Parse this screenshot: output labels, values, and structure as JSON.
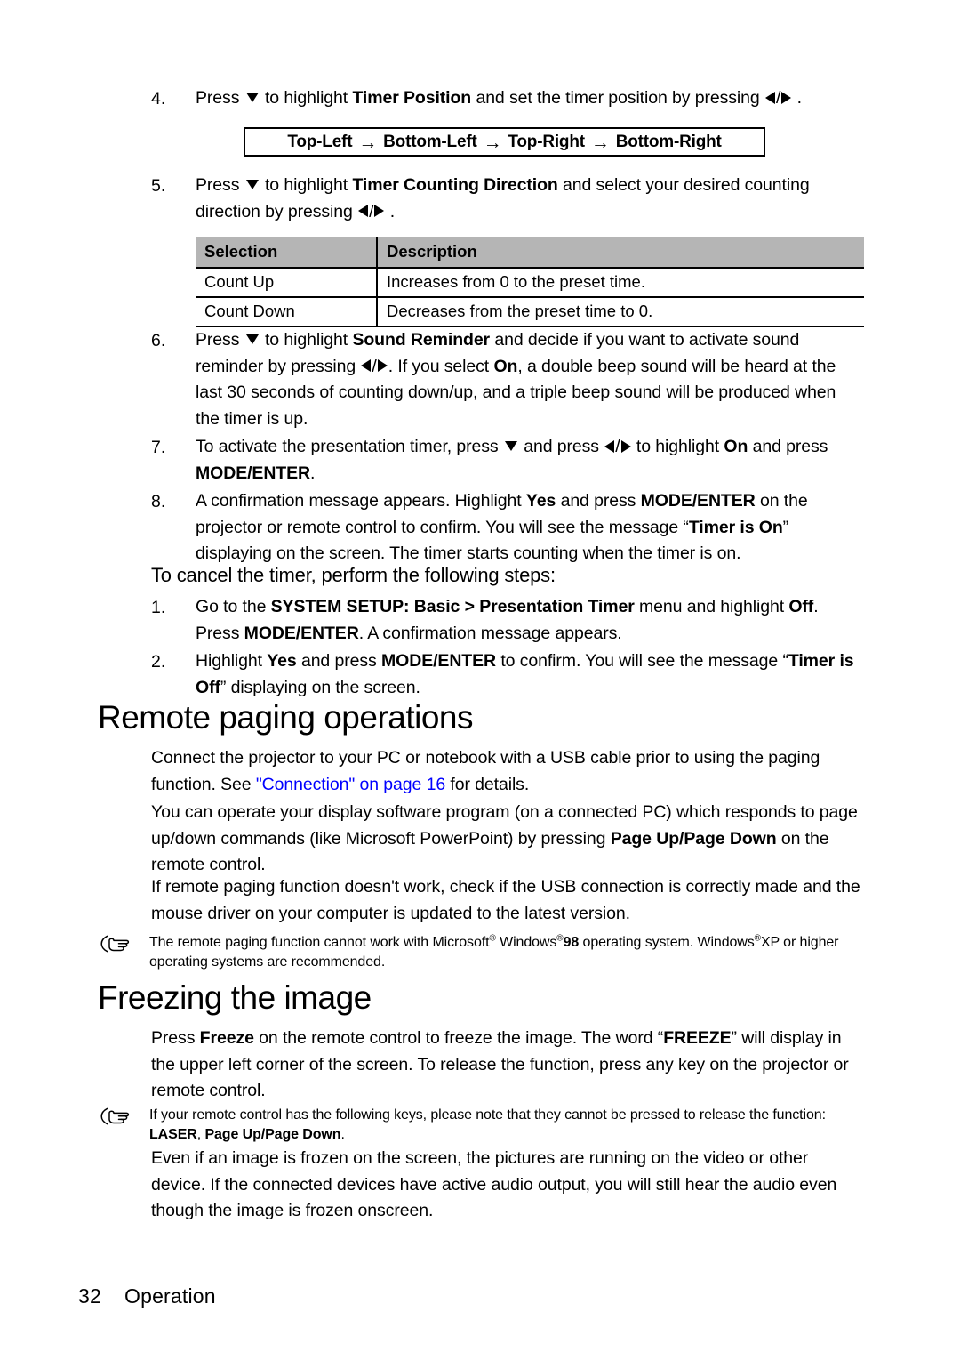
{
  "page": {
    "footer_page_number": "32",
    "footer_section": "Operation",
    "link_color": "#0000ff",
    "table_header_bg": "#b5b5b5"
  },
  "steps_timer": [
    {
      "num": "4.",
      "parts": [
        {
          "t": "Press ",
          "s": "n"
        },
        {
          "t": "▼",
          "s": "icon-down"
        },
        {
          "t": " to highlight ",
          "s": "n"
        },
        {
          "t": "Timer Position",
          "s": "b"
        },
        {
          "t": " and set the timer position by pressing ",
          "s": "n"
        },
        {
          "t": "◀ / ▶",
          "s": "icon-lr"
        },
        {
          "t": " .",
          "s": "n"
        }
      ]
    },
    {
      "num": "5.",
      "parts": [
        {
          "t": "Press ",
          "s": "n"
        },
        {
          "t": "▼",
          "s": "icon-down"
        },
        {
          "t": " to highlight ",
          "s": "n"
        },
        {
          "t": "Timer Counting Direction",
          "s": "b"
        },
        {
          "t": " and select your desired counting direction by pressing ",
          "s": "n"
        },
        {
          "t": "◀ / ▶",
          "s": "icon-lr"
        },
        {
          "t": " .",
          "s": "n"
        }
      ]
    },
    {
      "num": "6.",
      "parts": [
        {
          "t": "Press ",
          "s": "n"
        },
        {
          "t": "▼",
          "s": "icon-down"
        },
        {
          "t": " to highlight ",
          "s": "n"
        },
        {
          "t": "Sound Reminder",
          "s": "b"
        },
        {
          "t": " and decide if you want to activate sound reminder by pressing ",
          "s": "n"
        },
        {
          "t": "◀ / ▶",
          "s": "icon-lr"
        },
        {
          "t": ". If you select ",
          "s": "n"
        },
        {
          "t": "On",
          "s": "b"
        },
        {
          "t": ", a double beep sound will be heard at the last 30 seconds of counting down/up, and a triple beep sound will be produced when the timer is up.",
          "s": "n"
        }
      ]
    },
    {
      "num": "7.",
      "parts": [
        {
          "t": "To activate the presentation timer, press ",
          "s": "n"
        },
        {
          "t": "▼",
          "s": "icon-down"
        },
        {
          "t": " and press ",
          "s": "n"
        },
        {
          "t": "◀ / ▶",
          "s": "icon-lr"
        },
        {
          "t": " to highlight ",
          "s": "n"
        },
        {
          "t": "On",
          "s": "b"
        },
        {
          "t": " and press ",
          "s": "n"
        },
        {
          "t": "MODE/ENTER",
          "s": "b"
        },
        {
          "t": ".",
          "s": "n"
        }
      ]
    },
    {
      "num": "8.",
      "parts": [
        {
          "t": "A confirmation message appears. Highlight ",
          "s": "n"
        },
        {
          "t": "Yes",
          "s": "b"
        },
        {
          "t": " and press ",
          "s": "n"
        },
        {
          "t": "MODE/ENTER",
          "s": "b"
        },
        {
          "t": " on the projector or remote control to confirm. You will see the message “",
          "s": "n"
        },
        {
          "t": "Timer is On",
          "s": "b"
        },
        {
          "t": "” displaying on the screen. The timer starts counting when the timer is on.",
          "s": "n"
        }
      ]
    }
  ],
  "cycle_box": {
    "items": [
      "Top-Left",
      "Bottom-Left",
      "Top-Right",
      "Bottom-Right"
    ],
    "arrow": "→"
  },
  "selection_table": {
    "headers": [
      "Selection",
      "Description"
    ],
    "rows": [
      [
        "Count Up",
        "Increases from 0 to the preset time."
      ],
      [
        "Count Down",
        "Decreases from the preset time to 0."
      ]
    ]
  },
  "cancel_heading": "To cancel the timer, perform the following steps:",
  "steps_cancel": [
    {
      "num": "1.",
      "parts": [
        {
          "t": "Go to the ",
          "s": "n"
        },
        {
          "t": "SYSTEM SETUP: Basic > Presentation Timer",
          "s": "b"
        },
        {
          "t": " menu and highlight ",
          "s": "n"
        },
        {
          "t": "Off",
          "s": "b"
        },
        {
          "t": ". Press ",
          "s": "n"
        },
        {
          "t": "MODE/ENTER",
          "s": "b"
        },
        {
          "t": ". A confirmation message appears.",
          "s": "n"
        }
      ]
    },
    {
      "num": "2.",
      "parts": [
        {
          "t": "Highlight ",
          "s": "n"
        },
        {
          "t": "Yes",
          "s": "b"
        },
        {
          "t": " and press ",
          "s": "n"
        },
        {
          "t": "MODE/ENTER",
          "s": "b"
        },
        {
          "t": " to confirm. You will see the message “",
          "s": "n"
        },
        {
          "t": "Timer is Off",
          "s": "b"
        },
        {
          "t": "” displaying on the screen.",
          "s": "n"
        }
      ]
    }
  ],
  "remote_paging": {
    "heading": "Remote paging operations",
    "para1": [
      {
        "t": "Connect the projector to your PC or notebook with a USB cable prior to using the paging function. See ",
        "s": "n"
      },
      {
        "t": "\"Connection\" on page 16",
        "s": "link"
      },
      {
        "t": " for details.",
        "s": "n"
      }
    ],
    "para2": [
      {
        "t": "You can operate your display software program (on a connected PC) which responds to page up/down commands (like Microsoft PowerPoint) by pressing ",
        "s": "n"
      },
      {
        "t": "Page Up/Page Down",
        "s": "b"
      },
      {
        "t": " on the remote control.",
        "s": "n"
      }
    ],
    "para3": [
      {
        "t": "If remote paging function doesn't work, check if the USB connection is correctly made and the mouse driver on your computer is updated to the latest version.",
        "s": "n"
      }
    ],
    "note": [
      {
        "t": "The remote paging function cannot work with Microsoft",
        "s": "n"
      },
      {
        "t": "®",
        "s": "sup"
      },
      {
        "t": " Windows",
        "s": "n"
      },
      {
        "t": "®",
        "s": "sup"
      },
      {
        "t": "98",
        "s": "b"
      },
      {
        "t": " operating system. Windows",
        "s": "n"
      },
      {
        "t": "®",
        "s": "sup"
      },
      {
        "t": "XP or higher operating systems are recommended.",
        "s": "n"
      }
    ]
  },
  "freezing": {
    "heading": "Freezing the image",
    "para1": [
      {
        "t": "Press ",
        "s": "n"
      },
      {
        "t": "Freeze",
        "s": "b"
      },
      {
        "t": " on the remote control to freeze the image. The word “",
        "s": "n"
      },
      {
        "t": "FREEZE",
        "s": "b"
      },
      {
        "t": "” will display in the upper left corner of the screen. To release the function, press any key on the projector or remote control.",
        "s": "n"
      }
    ],
    "note": [
      {
        "t": "If your remote control has the following keys, please note that they cannot be pressed to release the function: ",
        "s": "n"
      },
      {
        "t": "LASER",
        "s": "b"
      },
      {
        "t": ", ",
        "s": "n"
      },
      {
        "t": "Page Up/Page Down",
        "s": "b"
      },
      {
        "t": ".",
        "s": "n"
      }
    ],
    "para2": [
      {
        "t": "Even if an image is frozen on the screen, the pictures are running on the video or other device. If the connected devices have active audio output, you will still hear the audio even though the image is frozen onscreen.",
        "s": "n"
      }
    ]
  }
}
